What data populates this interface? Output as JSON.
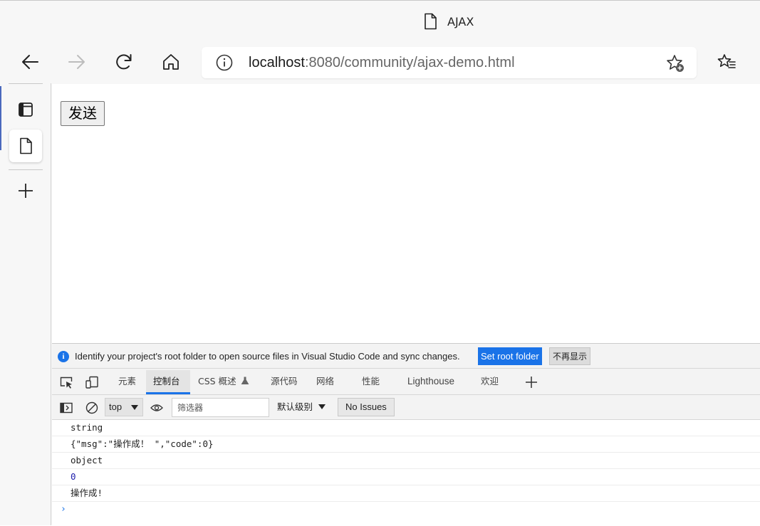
{
  "titlebar": {
    "title": "AJAX"
  },
  "addressbar": {
    "host": "localhost",
    "rest": ":8080/community/ajax-demo.html"
  },
  "page": {
    "send_button": "发送"
  },
  "infobar": {
    "message": "Identify your project's root folder to open source files in Visual Studio Code and sync changes.",
    "set_root": "Set root folder",
    "dismiss": "不再显示"
  },
  "devtools": {
    "tabs": [
      "元素",
      "控制台",
      "CSS 概述",
      "源代码",
      "网络",
      "性能",
      "Lighthouse",
      "欢迎"
    ],
    "active_tab": "控制台"
  },
  "console_toolbar": {
    "context": "top",
    "filter_placeholder": "筛选器",
    "level": "默认级别",
    "issues": "No Issues"
  },
  "console_log": [
    "string",
    "{\"msg\":\"操作成！ \",\"code\":0}",
    "object",
    "0",
    "操作成!"
  ],
  "colors": {
    "accent": "#1a73e8",
    "number": "#1c1cab"
  }
}
